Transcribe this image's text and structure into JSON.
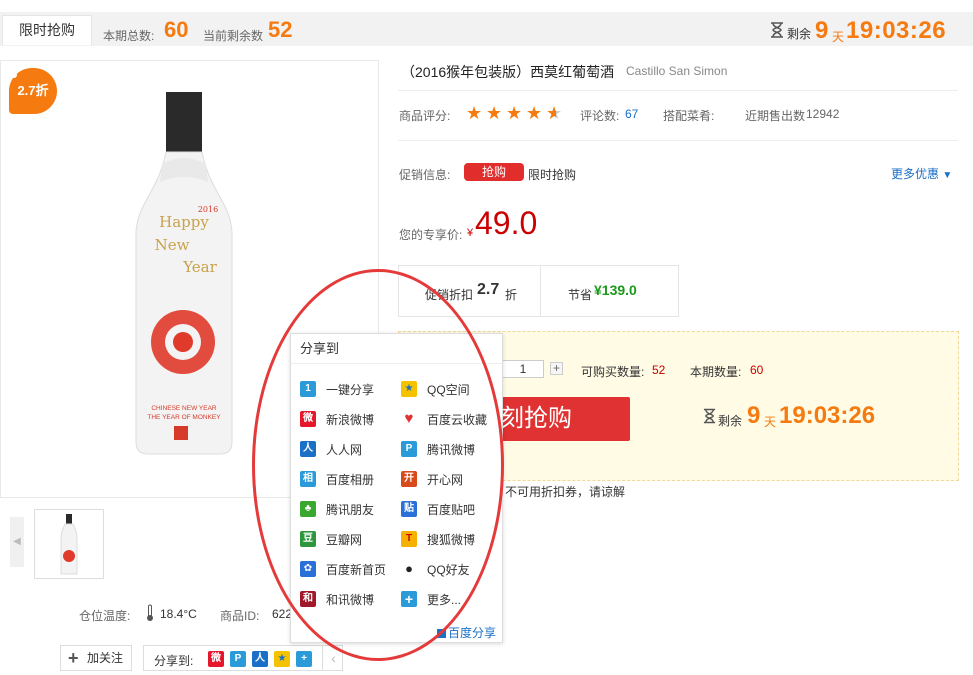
{
  "topbar": {
    "tab": "限时抢购",
    "total_label": "本期总数:",
    "total_value": "60",
    "remaining_label": "当前剩余数",
    "remaining_value": "52",
    "countdown_label": "剩余",
    "countdown_days": "9",
    "countdown_day_unit": "天",
    "countdown_time": "19:03:26"
  },
  "image": {
    "discount_badge": "2.7折",
    "bottle_text": [
      "Happy",
      "New",
      "Year",
      "2016",
      "CHINESE NEW YEAR",
      "THE YEAR OF MONKEY"
    ]
  },
  "details": {
    "temp_label": "仓位温度:",
    "temp_value": "18.4°C",
    "id_label": "商品ID:",
    "id_value": "622"
  },
  "actions": {
    "follow": "加关注",
    "share_label": "分享到:"
  },
  "product": {
    "title": "（2016猴年包装版）西莫红葡萄酒",
    "title_en": "Castillo San Simon",
    "rating_label": "商品评分:",
    "rating": 4.5,
    "review_label": "评论数:",
    "review_count": "67",
    "pairing_label": "搭配菜肴:",
    "recent_sales_label": "近期售出数",
    "recent_sales": "12942",
    "promo_label": "促销信息:",
    "promo_tag": "抢购",
    "promo_text": "限时抢购",
    "more_offers": "更多优惠",
    "price_label": "您的专享价:",
    "currency": "¥",
    "price": "49.0",
    "discount_label": "促销折扣",
    "discount_value": "2.7",
    "discount_unit": "折",
    "save_label": "节省",
    "save_value": "¥139.0"
  },
  "buy": {
    "qty": "1",
    "plus": "+",
    "avail_label": "可购买数量:",
    "avail_value": "52",
    "period_label": "本期数量:",
    "period_value": "60",
    "button": "刻抢购",
    "countdown_label": "剩余",
    "countdown_days": "9",
    "countdown_day_unit": "天",
    "countdown_time": "19:03:26",
    "note": "不可用折扣券，请谅解"
  },
  "share_popup": {
    "title": "分享到",
    "items_left": [
      "一键分享",
      "新浪微博",
      "人人网",
      "百度相册",
      "腾讯朋友",
      "豆瓣网",
      "百度新首页",
      "和讯微博"
    ],
    "items_right": [
      "QQ空间",
      "百度云收藏",
      "腾讯微博",
      "开心网",
      "百度贴吧",
      "搜狐微博",
      "QQ好友",
      "更多..."
    ],
    "footer": "百度分享"
  },
  "colors": {
    "accent": "#f57a10",
    "price_red": "#cc0000",
    "buy_button": "#e03232",
    "link_blue": "#1a6fc6",
    "annotation_ellipse": "#e53a3a"
  }
}
